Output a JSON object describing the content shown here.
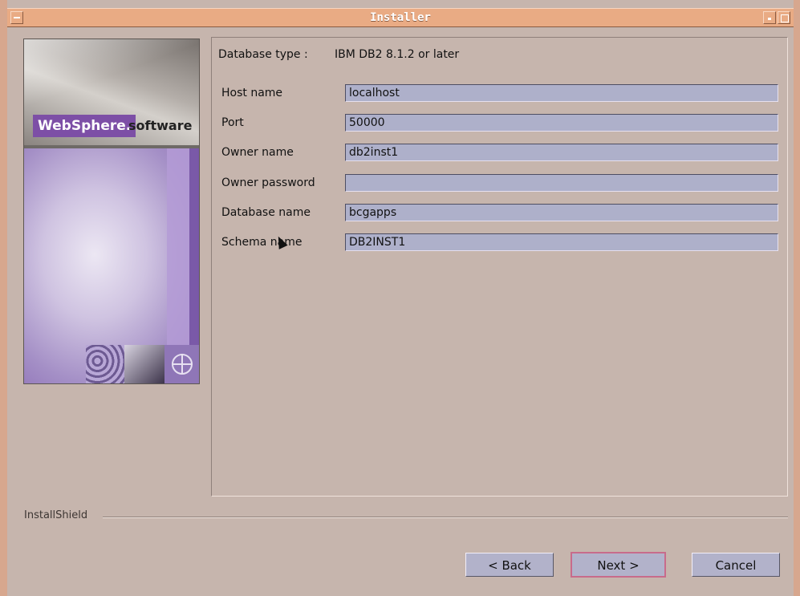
{
  "window": {
    "title": "Installer"
  },
  "banner": {
    "brand": "WebSphere.",
    "brand_suffix": "software"
  },
  "form": {
    "db_type_label": "Database type :",
    "db_type_value": "IBM DB2 8.1.2 or later",
    "fields": [
      {
        "label": "Host name",
        "value": "localhost"
      },
      {
        "label": "Port",
        "value": "50000"
      },
      {
        "label": "Owner name",
        "value": "db2inst1"
      },
      {
        "label": "Owner password",
        "value": ""
      },
      {
        "label": "Database name",
        "value": "bcgapps"
      },
      {
        "label": "Schema name",
        "value": "DB2INST1"
      }
    ]
  },
  "footer": {
    "installshield": "InstallShield"
  },
  "buttons": {
    "back": "< Back",
    "next": "Next >",
    "cancel": "Cancel"
  }
}
